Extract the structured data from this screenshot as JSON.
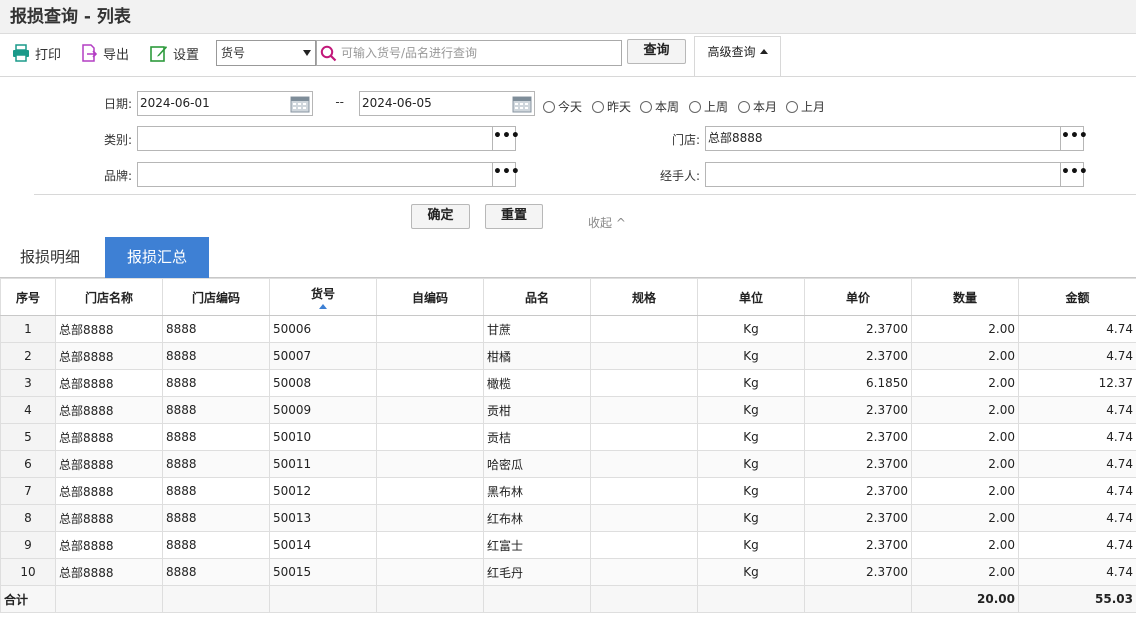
{
  "title": "报损查询 - 列表",
  "toolbar": {
    "print_label": "打印",
    "export_label": "导出",
    "settings_label": "设置",
    "search_field_selected": "货号",
    "search_placeholder": "可输入货号/品名进行查询",
    "query_label": "查询",
    "advanced_label": "高级查询"
  },
  "filters": {
    "date_label": "日期:",
    "date_from": "2024-06-01",
    "date_sep": "--",
    "date_to": "2024-06-05",
    "quick_ranges": [
      "今天",
      "昨天",
      "本周",
      "上周",
      "本月",
      "上月"
    ],
    "category_label": "类别:",
    "category_value": "",
    "brand_label": "品牌:",
    "brand_value": "",
    "store_label": "门店:",
    "store_value": "总部8888",
    "handler_label": "经手人:",
    "handler_value": "",
    "browse_label": "•••",
    "confirm_label": "确定",
    "reset_label": "重置",
    "collapse_label": "收起 ^"
  },
  "tabs": [
    {
      "label": "报损明细",
      "active": false
    },
    {
      "label": "报损汇总",
      "active": true
    }
  ],
  "colors": {
    "accent": "#3e80d4"
  },
  "table": {
    "columns": [
      "序号",
      "门店名称",
      "门店编码",
      "货号",
      "自编码",
      "品名",
      "规格",
      "单位",
      "单价",
      "数量",
      "金额"
    ],
    "sorted_column": "货号",
    "rows": [
      [
        "1",
        "总部8888",
        "8888",
        "50006",
        "",
        "甘蔗",
        "",
        "Kg",
        "2.3700",
        "2.00",
        "4.74"
      ],
      [
        "2",
        "总部8888",
        "8888",
        "50007",
        "",
        "柑橘",
        "",
        "Kg",
        "2.3700",
        "2.00",
        "4.74"
      ],
      [
        "3",
        "总部8888",
        "8888",
        "50008",
        "",
        "橄榄",
        "",
        "Kg",
        "6.1850",
        "2.00",
        "12.37"
      ],
      [
        "4",
        "总部8888",
        "8888",
        "50009",
        "",
        "贡柑",
        "",
        "Kg",
        "2.3700",
        "2.00",
        "4.74"
      ],
      [
        "5",
        "总部8888",
        "8888",
        "50010",
        "",
        "贡桔",
        "",
        "Kg",
        "2.3700",
        "2.00",
        "4.74"
      ],
      [
        "6",
        "总部8888",
        "8888",
        "50011",
        "",
        "哈密瓜",
        "",
        "Kg",
        "2.3700",
        "2.00",
        "4.74"
      ],
      [
        "7",
        "总部8888",
        "8888",
        "50012",
        "",
        "黑布林",
        "",
        "Kg",
        "2.3700",
        "2.00",
        "4.74"
      ],
      [
        "8",
        "总部8888",
        "8888",
        "50013",
        "",
        "红布林",
        "",
        "Kg",
        "2.3700",
        "2.00",
        "4.74"
      ],
      [
        "9",
        "总部8888",
        "8888",
        "50014",
        "",
        "红富士",
        "",
        "Kg",
        "2.3700",
        "2.00",
        "4.74"
      ],
      [
        "10",
        "总部8888",
        "8888",
        "50015",
        "",
        "红毛丹",
        "",
        "Kg",
        "2.3700",
        "2.00",
        "4.74"
      ]
    ],
    "total_label": "合计",
    "total_quantity": "20.00",
    "total_amount": "55.03"
  }
}
